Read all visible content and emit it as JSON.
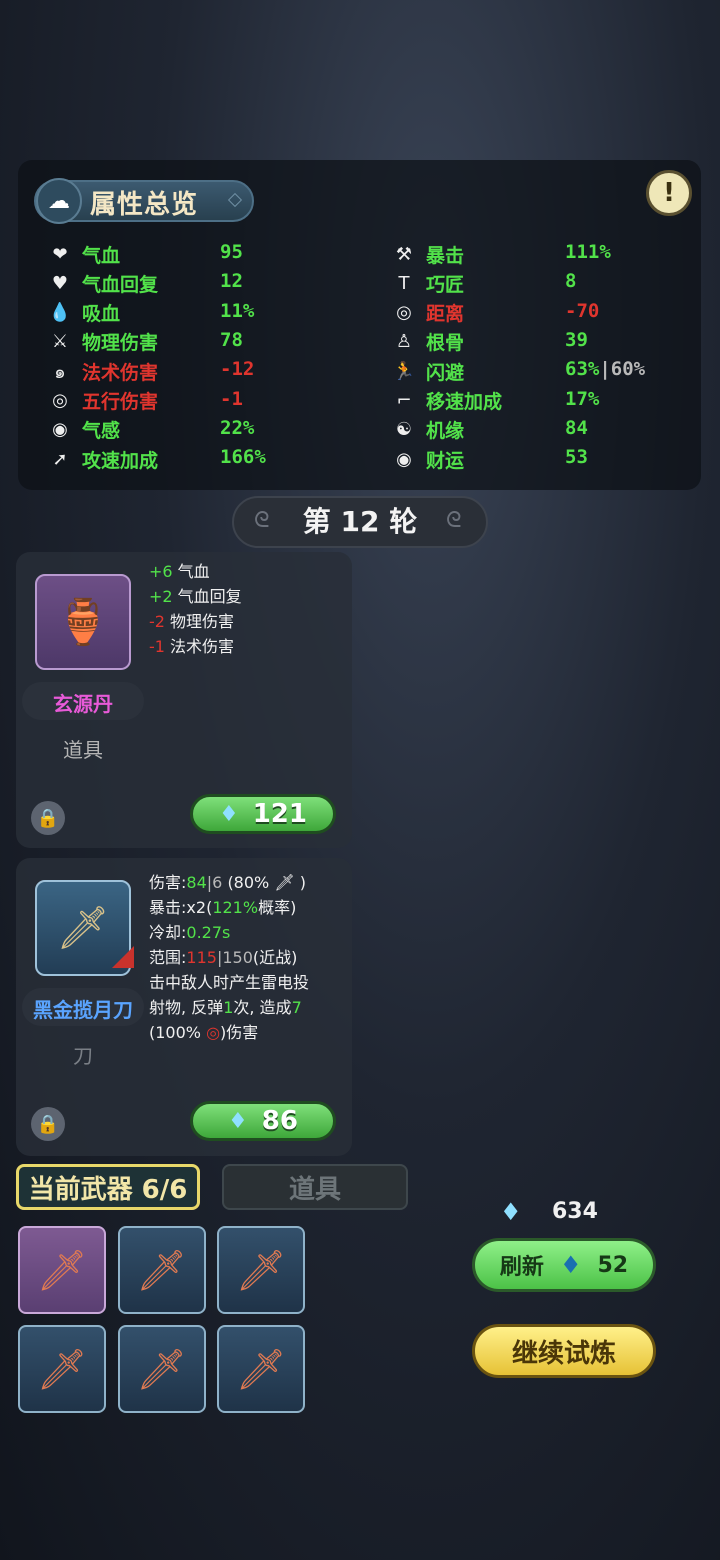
{
  "panel": {
    "title": "属性总览",
    "info_icon": "!"
  },
  "stats_left": [
    {
      "icon": "heart-icon",
      "glyph": "❤",
      "label": "气血",
      "value": "95",
      "label_color": "green",
      "value_color": "green"
    },
    {
      "icon": "heart-regen-icon",
      "glyph": "♥",
      "label": "气血回复",
      "value": "12",
      "label_color": "green",
      "value_color": "green"
    },
    {
      "icon": "drop-icon",
      "glyph": "💧",
      "label": "吸血",
      "value": "11%",
      "label_color": "green",
      "value_color": "green"
    },
    {
      "icon": "sword-icon",
      "glyph": "⚔",
      "label": "物理伤害",
      "value": "78",
      "label_color": "green",
      "value_color": "green"
    },
    {
      "icon": "spiral-icon",
      "glyph": "๑",
      "label": "法术伤害",
      "value": "-12",
      "label_color": "red",
      "value_color": "red"
    },
    {
      "icon": "element-icon",
      "glyph": "◎",
      "label": "五行伤害",
      "value": "-1",
      "label_color": "red",
      "value_color": "red"
    },
    {
      "icon": "qi-icon",
      "glyph": "◉",
      "label": "气感",
      "value": "22%",
      "label_color": "green",
      "value_color": "green"
    },
    {
      "icon": "attack-speed-icon",
      "glyph": "➚",
      "label": "攻速加成",
      "value": "166%",
      "label_color": "green",
      "value_color": "green"
    }
  ],
  "stats_right": [
    {
      "icon": "crit-icon",
      "glyph": "⚒",
      "label": "暴击",
      "value": "111%",
      "label_color": "green",
      "value_color": "green"
    },
    {
      "icon": "hammer-icon",
      "glyph": "T",
      "label": "巧匠",
      "value": "8",
      "label_color": "green",
      "value_color": "green"
    },
    {
      "icon": "target-icon",
      "glyph": "◎",
      "label": "距离",
      "value": "-70",
      "label_color": "red",
      "value_color": "red"
    },
    {
      "icon": "body-icon",
      "glyph": "♙",
      "label": "根骨",
      "value": "39",
      "label_color": "green",
      "value_color": "green"
    },
    {
      "icon": "dodge-icon",
      "glyph": "🏃",
      "label": "闪避",
      "value": "63%",
      "value_extra": "60%",
      "label_color": "green",
      "value_color": "green"
    },
    {
      "icon": "boot-icon",
      "glyph": "⌐",
      "label": "移速加成",
      "value": "17%",
      "label_color": "green",
      "value_color": "green"
    },
    {
      "icon": "luck-icon",
      "glyph": "☯",
      "label": "机缘",
      "value": "84",
      "label_color": "green",
      "value_color": "green"
    },
    {
      "icon": "coin-icon",
      "glyph": "◉",
      "label": "财运",
      "value": "53",
      "label_color": "green",
      "value_color": "green"
    }
  ],
  "round": {
    "label": "第 12 轮"
  },
  "shop_items": [
    {
      "name": "玄源丹",
      "type": "道具",
      "price": "121",
      "effects": [
        {
          "sign": "+6",
          "text": "气血",
          "color": "green"
        },
        {
          "sign": "+2",
          "text": "气血回复",
          "color": "green"
        },
        {
          "sign": "-2",
          "text": "物理伤害",
          "color": "red"
        },
        {
          "sign": "-1",
          "text": "法术伤害",
          "color": "red"
        }
      ]
    },
    {
      "name": "黑金揽月刀",
      "type": "刀",
      "price": "86",
      "damage_label": "伤害:",
      "damage_value": "84",
      "damage_extra": "6",
      "damage_pct": "(80%",
      "damage_close": ")",
      "crit_label": "暴击:",
      "crit_mult": "x2",
      "crit_open": "(",
      "crit_chance": "121%",
      "crit_tail": "概率)",
      "cooldown_label": "冷却:",
      "cooldown_value": "0.27s",
      "range_label": "范围:",
      "range_value": "115",
      "range_extra": "150",
      "range_tail": "(近战)",
      "desc_1": "击中敌人时产生雷电投",
      "desc_2a": "射物, 反弹",
      "desc_2b": "1",
      "desc_2c": "次, 造成",
      "desc_2d": "7",
      "desc_3a": "(100%",
      "desc_3b": ")伤害"
    }
  ],
  "tabs": {
    "weapons": "当前武器 6/6",
    "items": "道具"
  },
  "currency": {
    "amount": "634"
  },
  "refresh": {
    "label": "刷新",
    "cost": "52"
  },
  "continue": {
    "label": "继续试炼"
  },
  "weapon_slots": [
    {
      "name": "weapon-slot-1",
      "selected": true
    },
    {
      "name": "weapon-slot-2",
      "selected": false
    },
    {
      "name": "weapon-slot-3",
      "selected": false
    },
    {
      "name": "weapon-slot-4",
      "selected": false
    },
    {
      "name": "weapon-slot-5",
      "selected": false
    },
    {
      "name": "weapon-slot-6",
      "selected": false
    }
  ],
  "colors": {
    "green": "#52e24a",
    "red": "#e0352e",
    "gold": "#f2e6a8"
  }
}
